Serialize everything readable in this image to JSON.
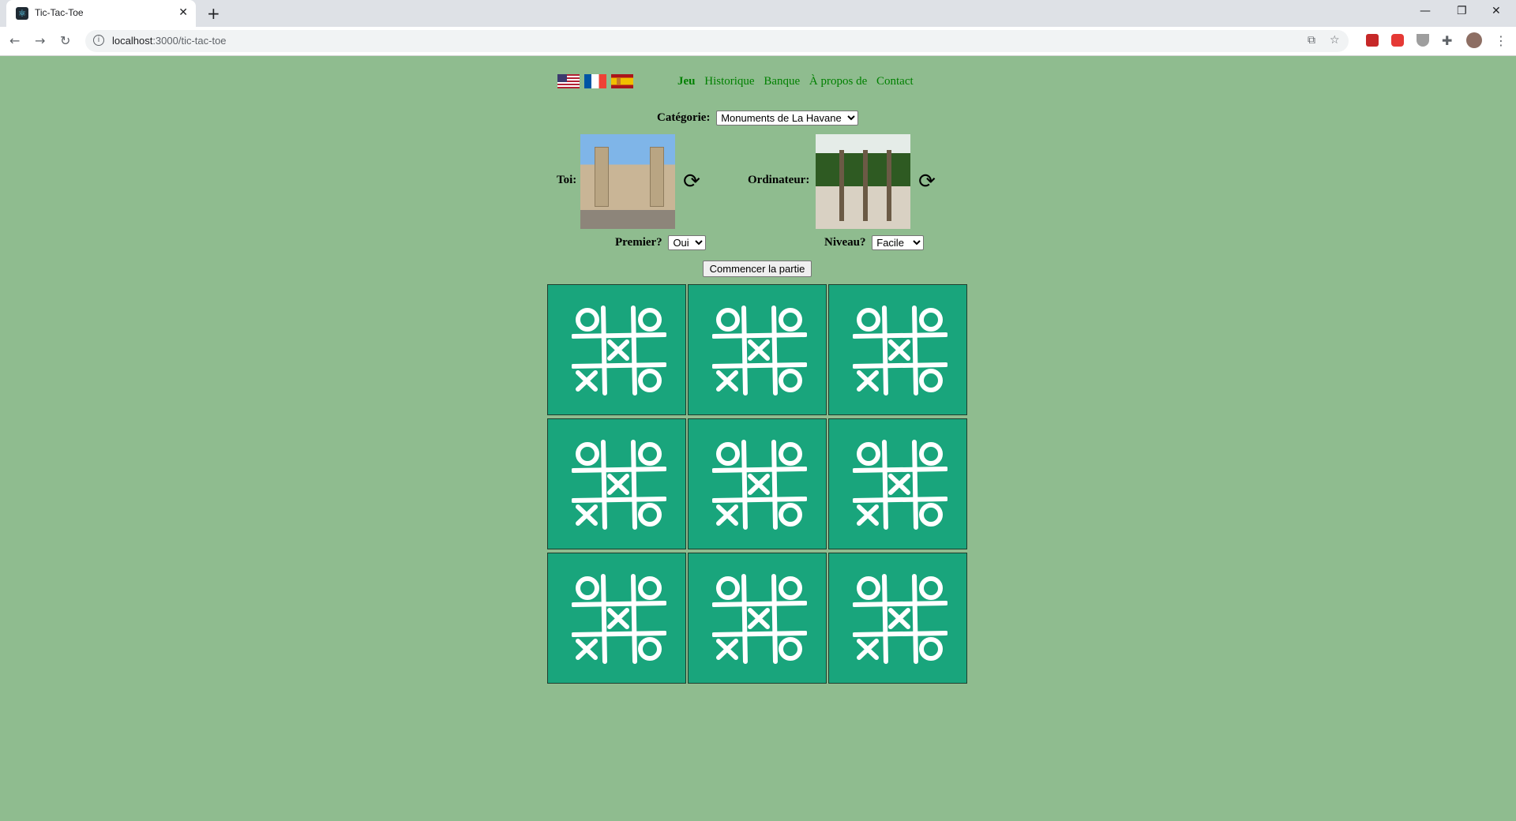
{
  "browser": {
    "tab_title": "Tic-Tac-Toe",
    "url_host": "localhost",
    "url_path": ":3000/tic-tac-toe"
  },
  "header": {
    "languages": [
      "us-flag",
      "fr-flag",
      "es-flag"
    ],
    "nav": [
      {
        "label": "Jeu",
        "active": true
      },
      {
        "label": "Historique",
        "active": false
      },
      {
        "label": "Banque",
        "active": false
      },
      {
        "label": "À propos de",
        "active": false
      },
      {
        "label": "Contact",
        "active": false
      }
    ]
  },
  "settings": {
    "category_label": "Catégorie:",
    "category_value": "Monuments de La Havane",
    "you_label": "Toi:",
    "computer_label": "Ordinateur:",
    "first_label": "Premier?",
    "first_value": "Oui",
    "level_label": "Niveau?",
    "level_value": "Facile",
    "start_button": "Commencer la partie"
  },
  "board": {
    "cells": 9,
    "cell_icon": "tic-tac-toe-icon"
  },
  "colors": {
    "page_bg": "#8fbc8f",
    "cell_bg": "#19a57c",
    "link": "#008000"
  }
}
